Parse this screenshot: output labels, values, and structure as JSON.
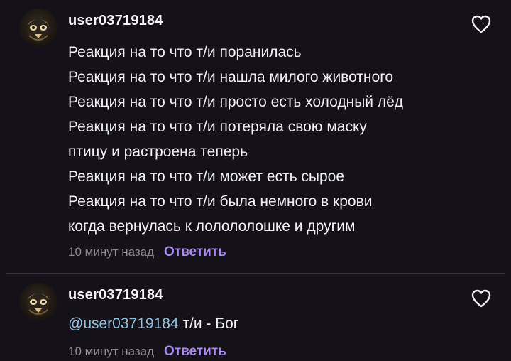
{
  "comments": [
    {
      "username": "user03719184",
      "lines": [
        "Реакция на то что т/и поранилась",
        "Реакция на то что т/и нашла милого животного",
        "Реакция на то что т/и просто есть холодный лёд",
        "Реакция на то что т/и потеряла свою маску",
        "птицу и растроена теперь",
        "Реакция на то что т/и может есть сырое",
        "Реакция на то что т/и была немного в крови",
        "когда вернулась к лолололошке и другим"
      ],
      "time": "10 минут назад",
      "reply_label": "Ответить",
      "like_icon": "heart-outline-icon"
    },
    {
      "username": "user03719184",
      "mention": "@user03719184",
      "text": " т/и - Бог",
      "time": "10 минут назад",
      "reply_label": "Ответить",
      "like_icon": "heart-outline-icon"
    }
  ],
  "colors": {
    "background": "#141118",
    "text": "#f0f0f2",
    "meta": "#8c8a92",
    "reply": "#a88cf0",
    "mention": "#8fc4e0",
    "divider": "#34313a"
  }
}
